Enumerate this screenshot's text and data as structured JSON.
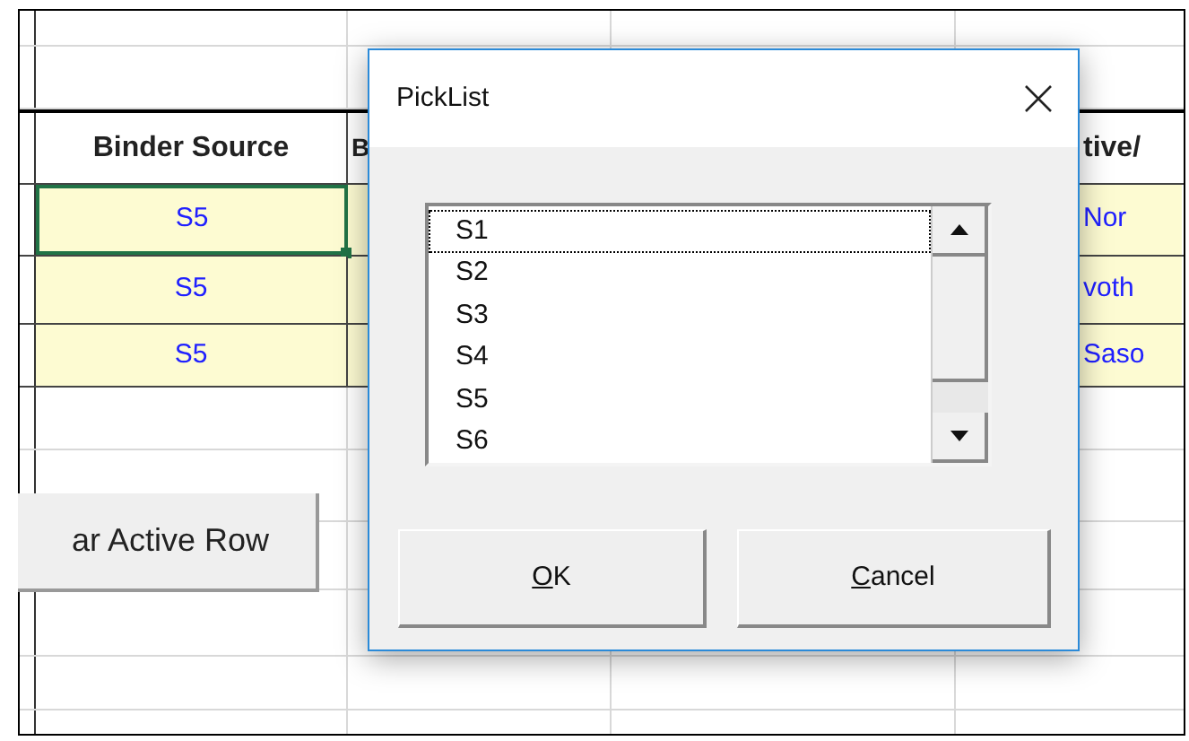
{
  "sheet": {
    "header": {
      "column_1": "Binder Source",
      "column_2": "B",
      "column_4": "tive/"
    },
    "rows": [
      {
        "column_1": "S5",
        "column_4": "Nor",
        "selected": true
      },
      {
        "column_1": "S5",
        "column_4": "voth",
        "selected": false
      },
      {
        "column_1": "S5",
        "column_4": "Saso",
        "selected": false
      }
    ],
    "button": "ar Active Row"
  },
  "dialog": {
    "title": "PickList",
    "list": [
      {
        "label": "S1",
        "focused": true,
        "selected": false
      },
      {
        "label": "S2",
        "focused": false,
        "selected": false
      },
      {
        "label": "S3",
        "focused": false,
        "selected": false
      },
      {
        "label": "S4",
        "focused": false,
        "selected": false
      },
      {
        "label": "S5",
        "focused": false,
        "selected": false
      },
      {
        "label": "S6",
        "focused": false,
        "selected": false
      }
    ],
    "buttons": [
      "OK",
      "Cancel"
    ]
  }
}
